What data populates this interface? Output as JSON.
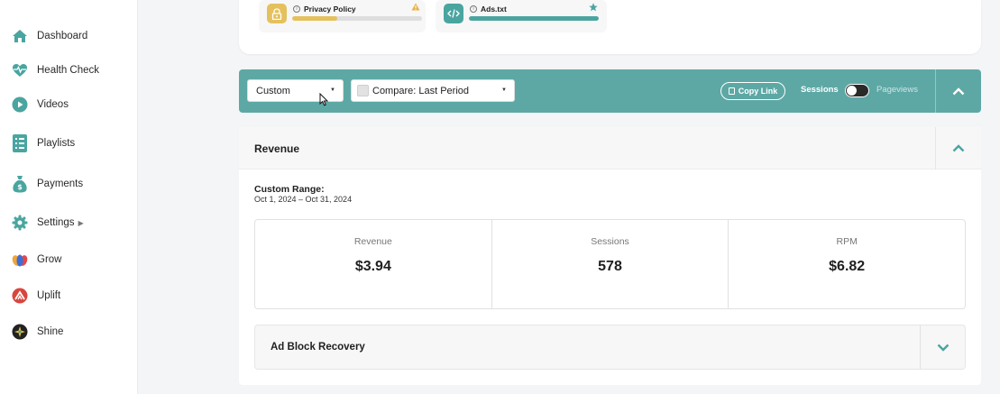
{
  "sidebar": {
    "items": [
      {
        "label": "Dashboard",
        "icon": "home-icon"
      },
      {
        "label": "Health Check",
        "icon": "heartbeat-icon"
      },
      {
        "label": "Videos",
        "icon": "play-icon"
      },
      {
        "label": "Playlists",
        "icon": "list-icon"
      },
      {
        "label": "Payments",
        "icon": "money-bag-icon"
      },
      {
        "label": "Settings",
        "icon": "gear-icon"
      },
      {
        "label": "Grow",
        "icon": "grow-icon"
      },
      {
        "label": "Uplift",
        "icon": "uplift-icon"
      },
      {
        "label": "Shine",
        "icon": "shine-icon"
      }
    ],
    "settings_caret": "▶"
  },
  "health_chips": [
    {
      "label": "Privacy Policy",
      "status_icon": "warning-icon",
      "progress": 0.35,
      "color": "#e5c15d"
    },
    {
      "label": "Ads.txt",
      "status_icon": "star-icon",
      "progress": 1.0,
      "color": "#4aa5a0"
    }
  ],
  "filters": {
    "range_select": "Custom",
    "compare_select": "Compare: Last Period",
    "copy_link": "Copy Link",
    "toggle_left": "Sessions",
    "toggle_right": "Pageviews"
  },
  "revenue": {
    "title": "Revenue",
    "range_title": "Custom Range:",
    "range_dates": "Oct 1, 2024 – Oct 31, 2024",
    "metrics": [
      {
        "label": "Revenue",
        "value": "$3.94"
      },
      {
        "label": "Sessions",
        "value": "578"
      },
      {
        "label": "RPM",
        "value": "$6.82"
      }
    ]
  },
  "ad_block": {
    "title": "Ad Block Recovery"
  },
  "colors": {
    "teal": "#5da8a5",
    "accent_icon": "#4aa5a0"
  }
}
